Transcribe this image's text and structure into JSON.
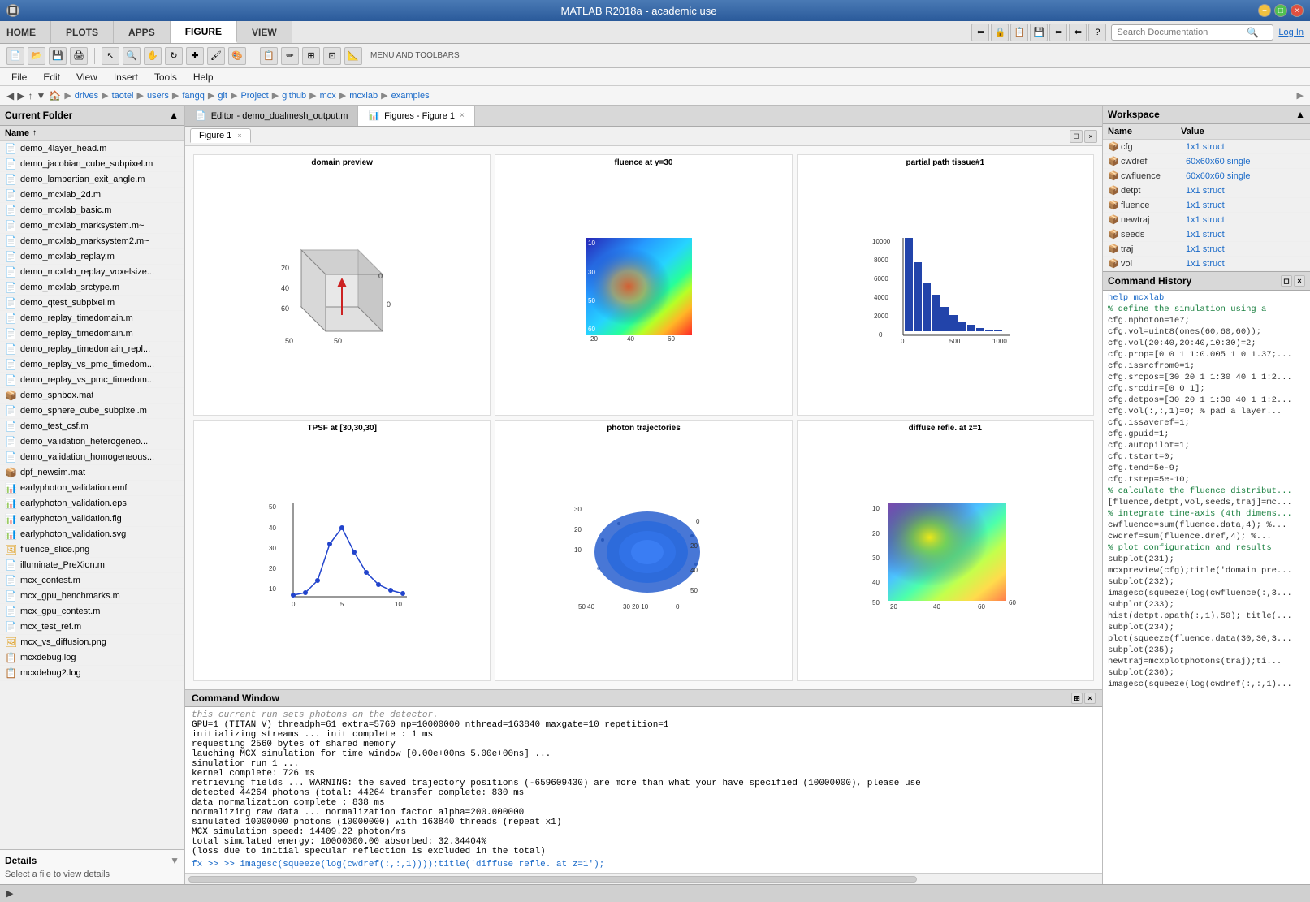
{
  "titlebar": {
    "title": "MATLAB R2018a - academic use"
  },
  "main_tabs": [
    {
      "label": "HOME",
      "active": false
    },
    {
      "label": "PLOTS",
      "active": false
    },
    {
      "label": "APPS",
      "active": false
    },
    {
      "label": "FIGURE",
      "active": true
    },
    {
      "label": "VIEW",
      "active": false
    }
  ],
  "search": {
    "placeholder": "Search Documentation"
  },
  "login": {
    "label": "Log In"
  },
  "menubar": {
    "items": [
      "File",
      "Edit",
      "View",
      "Insert",
      "Tools",
      "Help"
    ]
  },
  "ribbon_label": "MENU AND TOOLBARS",
  "pathbar": {
    "parts": [
      "drives",
      "taotel",
      "users",
      "fangq",
      "git",
      "Project",
      "github",
      "mcx",
      "mcxlab",
      "examples"
    ]
  },
  "left_panel": {
    "header": "Current Folder",
    "col_name": "Name",
    "files": [
      "demo_4layer_head.m",
      "demo_jacobian_cube_subpixel.m",
      "demo_lambertian_exit_angle.m",
      "demo_mcxlab_2d.m",
      "demo_mcxlab_basic.m",
      "demo_mcxlab_marksystem.m~",
      "demo_mcxlab_marksystem2.m~",
      "demo_mcxlab_replay.m",
      "demo_mcxlab_replay_voxelsize...",
      "demo_mcxlab_srctype.m",
      "demo_qtest_subpixel.m",
      "demo_replay_timedomain.m",
      "demo_replay_timedomain.m",
      "demo_replay_timedomain_repl...",
      "demo_replay_vs_pmc_timedom...",
      "demo_replay_vs_pmc_timedom...",
      "demo_sphbox.mat",
      "demo_sphere_cube_subpixel.m",
      "demo_test_csf.m",
      "demo_validation_heterogeneo...",
      "demo_validation_homogeneous...",
      "dpf_newsim.mat",
      "earlyphoton_validation.emf",
      "earlyphoton_validation.eps",
      "earlyphoton_validation.fig",
      "earlyphoton_validation.svg",
      "fluence_slice.png",
      "illuminate_PreXion.m",
      "mcx_contest.m",
      "mcx_gpu_benchmarks.m",
      "mcx_gpu_contest.m",
      "mcx_test_ref.m",
      "mcx_vs_diffusion.png",
      "mcxdebug.log",
      "mcxdebug2.log"
    ]
  },
  "details_panel": {
    "header": "Details",
    "content": "Select a file to view details"
  },
  "editor_tabs": [
    {
      "label": "Editor - demo_dualmesh_output.m",
      "active": false,
      "icon": "📄"
    },
    {
      "label": "Figures - Figure 1",
      "active": true,
      "icon": "📊"
    }
  ],
  "figure_tabs": [
    {
      "label": "Figure 1",
      "active": true
    }
  ],
  "subplots": [
    {
      "title": "domain preview",
      "type": "3dbox"
    },
    {
      "title": "fluence at y=30",
      "type": "heatmap_cool"
    },
    {
      "title": "partial path tissue#1",
      "type": "histogram"
    },
    {
      "title": "TPSF at [30,30,30]",
      "type": "lineplot"
    },
    {
      "title": "photon trajectories",
      "type": "scatter3d"
    },
    {
      "title": "diffuse refle. at z=1",
      "type": "heatmap_warm"
    }
  ],
  "workspace": {
    "header": "Workspace",
    "col_name": "Name",
    "col_value": "Value",
    "variables": [
      {
        "name": "cfg",
        "value": "1x1 struct"
      },
      {
        "name": "cwdref",
        "value": "60x60x60 single"
      },
      {
        "name": "cwfluence",
        "value": "60x60x60 single"
      },
      {
        "name": "detpt",
        "value": "1x1 struct"
      },
      {
        "name": "fluence",
        "value": "1x1 struct"
      },
      {
        "name": "newtraj",
        "value": "1x1 struct"
      },
      {
        "name": "seeds",
        "value": "1x1 struct"
      },
      {
        "name": "traj",
        "value": "1x1 struct"
      },
      {
        "name": "vol",
        "value": "1x1 struct"
      }
    ]
  },
  "command_history": {
    "header": "Command History",
    "lines": [
      {
        "text": "help mcxlab",
        "type": "highlight"
      },
      {
        "text": "% define the simulation using a",
        "type": "comment"
      },
      {
        "text": "cfg.nphoton=1e7;",
        "type": "normal"
      },
      {
        "text": "cfg.vol=uint8(ones(60,60,60));",
        "type": "normal"
      },
      {
        "text": "cfg.vol(20:40,20:40,10:30)=2;",
        "type": "normal"
      },
      {
        "text": "cfg.prop=[0 0 1 1:0.005 1 0 1.37;...",
        "type": "normal"
      },
      {
        "text": "cfg.issrcfrom0=1;",
        "type": "normal"
      },
      {
        "text": "cfg.srcpos=[30 20 1 1:30 40 1 1:2...",
        "type": "normal"
      },
      {
        "text": "cfg.srcdir=[0 0 1];",
        "type": "normal"
      },
      {
        "text": "cfg.detpos=[30 20 1 1:30 40 1 1:2...",
        "type": "normal"
      },
      {
        "text": "cfg.vol(:,:,1)=0;  % pad a layer...",
        "type": "normal"
      },
      {
        "text": "cfg.issaveref=1;",
        "type": "normal"
      },
      {
        "text": "cfg.gpuid=1;",
        "type": "normal"
      },
      {
        "text": "cfg.autopilot=1;",
        "type": "normal"
      },
      {
        "text": "cfg.tstart=0;",
        "type": "normal"
      },
      {
        "text": "cfg.tend=5e-9;",
        "type": "normal"
      },
      {
        "text": "cfg.tstep=5e-10;",
        "type": "normal"
      },
      {
        "text": "% calculate the fluence distribut...",
        "type": "comment"
      },
      {
        "text": "[fluence,detpt,vol,seeds,traj]=mc...",
        "type": "normal"
      },
      {
        "text": "% integrate time-axis (4th dimens...",
        "type": "comment"
      },
      {
        "text": "cwfluence=sum(fluence.data,4);  %...",
        "type": "normal"
      },
      {
        "text": "cwdref=sum(fluence.dref,4);    %...",
        "type": "normal"
      },
      {
        "text": "% plot configuration and results",
        "type": "comment"
      },
      {
        "text": "subplot(231);",
        "type": "normal"
      },
      {
        "text": "mcxpreview(cfg);title('domain pre...",
        "type": "normal"
      },
      {
        "text": "subplot(232);",
        "type": "normal"
      },
      {
        "text": "imagesc(squeeze(log(cwfluence(:,3...",
        "type": "normal"
      },
      {
        "text": "subplot(233);",
        "type": "normal"
      },
      {
        "text": "hist(detpt.ppath(:,1),50); title(...",
        "type": "normal"
      },
      {
        "text": "subplot(234);",
        "type": "normal"
      },
      {
        "text": "plot(squeeze(fluence.data(30,30,3...",
        "type": "normal"
      },
      {
        "text": "subplot(235);",
        "type": "normal"
      },
      {
        "text": "newtraj=mcxplotphotons(traj);ti...",
        "type": "normal"
      },
      {
        "text": "subplot(236);",
        "type": "normal"
      },
      {
        "text": "imagesc(squeeze(log(cwdref(:,:,1)...",
        "type": "normal"
      }
    ]
  },
  "command_window": {
    "header": "Command Window",
    "lines": [
      "this current run sets photons on the detector.",
      "GPU=1 (TITAN V) threadph=61 extra=5760 np=10000000 nthread=163840 maxgate=10 repetition=1",
      "initializing streams ...      init complete : 1 ms",
      "requesting 2560 bytes of shared memory",
      "lauching MCX simulation for time window [0.00e+00ns 5.00e+00ns] ...",
      "simulation run 1 ...",
      "kernel complete:     726 ms",
      "retrieving fields ...  WARNING: the saved trajectory positions (-659609430) are more than what your have specified (10000000), please use",
      "detected 44264 photons (total: 44264    transfer complete:     830 ms",
      "data normalization complete : 838 ms",
      "normalizing raw data ...    normalization factor alpha=200.000000",
      "simulated 10000000 photons (10000000) with 163840 threads (repeat x1)",
      "MCX simulation speed: 14409.22 photon/ms",
      "total simulated energy: 10000000.00    absorbed:  32.34404%",
      "(loss due to initial specular reflection is excluded in the total)"
    ],
    "prompt_line": ">> imagesc(squeeze(log(cwdref(:,:,1))));title('diffuse refle. at z=1');"
  },
  "status_bar": {
    "text": ""
  }
}
